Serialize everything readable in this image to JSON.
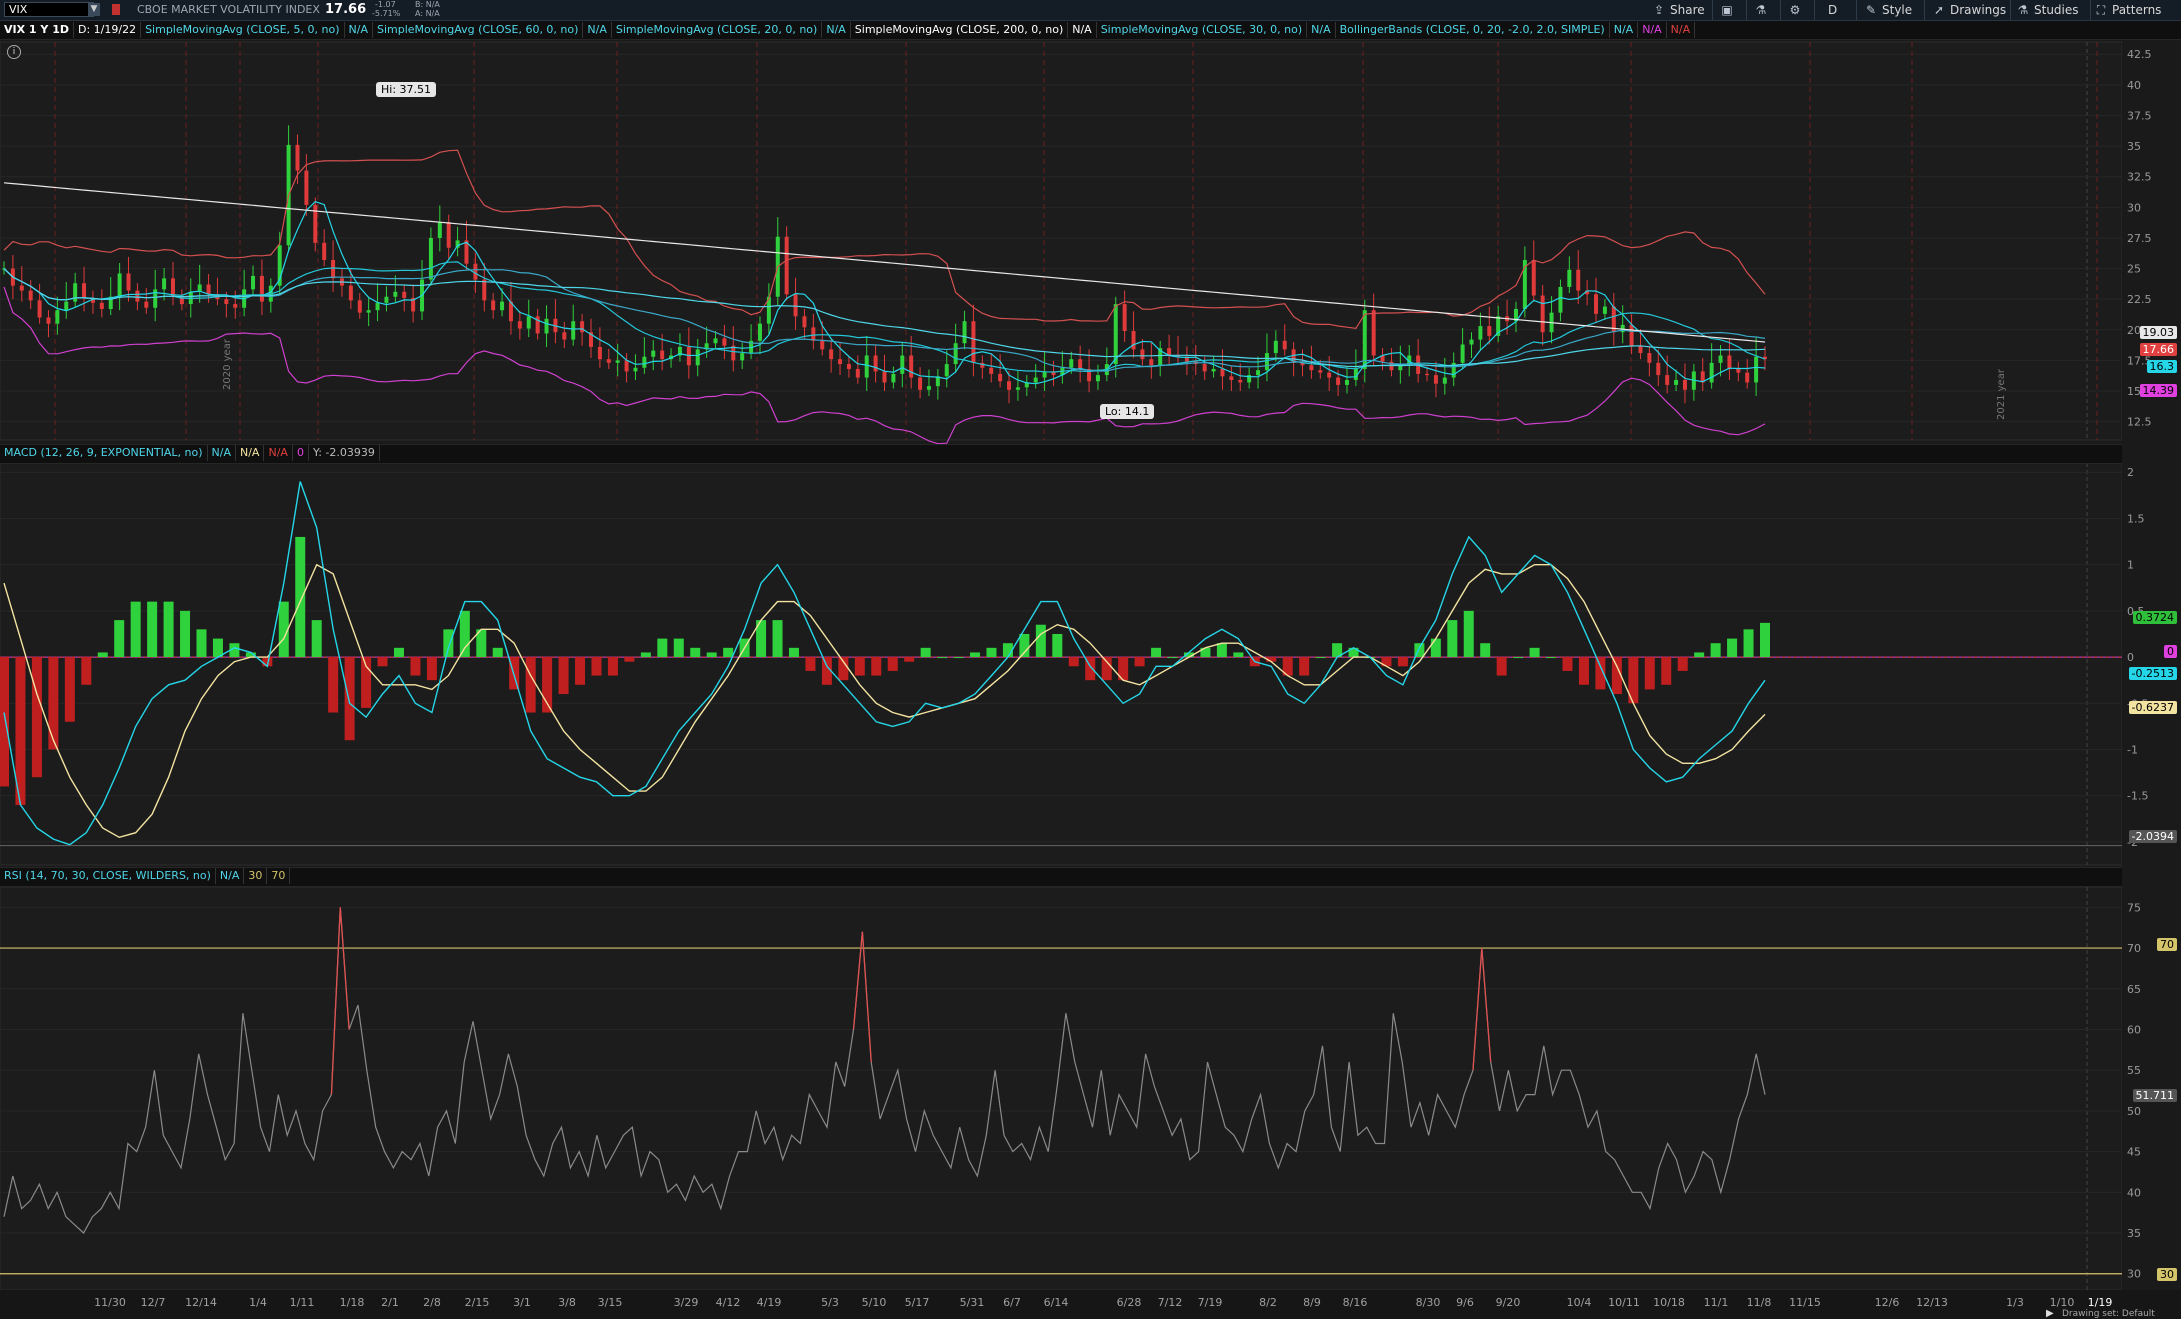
{
  "toolbar": {
    "symbol": "VIX",
    "description": "CBOE MARKET VOLATILITY INDEX",
    "last": "17.66",
    "change": "-1.07",
    "change_pct": "-5.71%",
    "bid": "B: N/A",
    "ask": "A: N/A",
    "share": "Share",
    "timeframe": "D",
    "style": "Style",
    "drawings": "Drawings",
    "studies": "Studies",
    "patterns": "Patterns"
  },
  "study_bar": {
    "chart_label": "VIX 1 Y 1D",
    "date": "D: 1/19/22",
    "studies": [
      {
        "label": "SimpleMovingAvg (CLOSE, 5, 0, no)",
        "value": "N/A",
        "color": "#4fd6e8"
      },
      {
        "label": "SimpleMovingAvg (CLOSE, 60, 0, no)",
        "value": "N/A",
        "color": "#4fd6e8"
      },
      {
        "label": "SimpleMovingAvg (CLOSE, 20, 0, no)",
        "value": "N/A",
        "color": "#4fd6e8"
      },
      {
        "label": "SimpleMovingAvg (CLOSE, 200, 0, no)",
        "value": "N/A",
        "color": "#ffffff"
      },
      {
        "label": "SimpleMovingAvg (CLOSE, 30, 0, no)",
        "value": "N/A",
        "color": "#4fd6e8"
      }
    ],
    "bollinger": {
      "label": "BollingerBands (CLOSE, 0, 20, -2.0, 2.0, SIMPLE)",
      "values": [
        "N/A",
        "N/A",
        "N/A"
      ]
    }
  },
  "price_panel": {
    "hi_label": "Hi: 37.51",
    "lo_label": "Lo: 14.1",
    "axis_ticks": [
      "42.5",
      "40",
      "37.5",
      "35",
      "32.5",
      "30",
      "27.5",
      "25",
      "22.5",
      "20",
      "17.5",
      "15",
      "12.5"
    ],
    "tags": [
      {
        "text": "19.03",
        "color": "#ffffff",
        "bg": "#e8e8e8",
        "fg": "#000000"
      },
      {
        "text": "17.66",
        "color": "#e04040",
        "bg": "#e04040",
        "fg": "#ffffff"
      },
      {
        "text": "16.3",
        "color": "#24d6e8",
        "bg": "#24d6e8",
        "fg": "#000000"
      },
      {
        "text": "14.39",
        "color": "#e040e0",
        "bg": "#e040e0",
        "fg": "#000000"
      }
    ],
    "year_labels": [
      "2020 year",
      "2021 year"
    ]
  },
  "macd_panel": {
    "label": "MACD (12, 26, 9, EXPONENTIAL, no)",
    "values": [
      "N/A",
      "N/A",
      "N/A",
      "0"
    ],
    "y_readout": "Y: -2.03939",
    "axis_ticks": [
      "2",
      "1.5",
      "1",
      "0.5",
      "0",
      "-0.5",
      "-1",
      "-1.5",
      "-2"
    ],
    "tags": [
      {
        "text": "0.3724",
        "bg": "#2fbf3a",
        "fg": "#000000"
      },
      {
        "text": "0",
        "bg": "#e040e0",
        "fg": "#000000"
      },
      {
        "text": "-0.2513",
        "bg": "#24d6e8",
        "fg": "#000000"
      },
      {
        "text": "-0.6237",
        "bg": "#f3e3a0",
        "fg": "#000000"
      },
      {
        "text": "-2.0394",
        "bg": "#555555",
        "fg": "#ffffff"
      }
    ]
  },
  "rsi_panel": {
    "label": "RSI (14, 70, 30, CLOSE, WILDERS, no)",
    "values": [
      "N/A",
      "30",
      "70"
    ],
    "axis_ticks": [
      "75",
      "70",
      "65",
      "60",
      "55",
      "50",
      "45",
      "40",
      "35",
      "30"
    ],
    "tags": [
      {
        "text": "70",
        "bg": "#d4c46a",
        "fg": "#000000"
      },
      {
        "text": "51.711",
        "bg": "#555555",
        "fg": "#ffffff"
      },
      {
        "text": "30",
        "bg": "#d4c46a",
        "fg": "#000000"
      }
    ]
  },
  "x_axis": {
    "labels": [
      "11/30",
      "12/7",
      "12/14",
      "1/4",
      "1/11",
      "1/18",
      "2/1",
      "2/8",
      "2/15",
      "3/1",
      "3/8",
      "3/15",
      "3/29",
      "4/12",
      "4/19",
      "5/3",
      "5/10",
      "5/17",
      "5/31",
      "6/7",
      "6/14",
      "6/28",
      "7/12",
      "7/19",
      "8/2",
      "8/9",
      "8/16",
      "8/30",
      "9/6",
      "9/20",
      "10/4",
      "10/11",
      "10/18",
      "11/1",
      "11/8",
      "11/15",
      "12/6",
      "12/13",
      "1/3",
      "1/10",
      "1/19"
    ]
  },
  "footer": {
    "drawing_set": "Drawing set: Default"
  },
  "chart_data": [
    {
      "type": "candlestick",
      "title": "VIX 1 Y 1D",
      "ylim": [
        11,
        43.5
      ],
      "hi": 37.51,
      "lo": 14.1,
      "close_series": [
        25,
        23.6,
        23.2,
        22.4,
        21,
        20.5,
        21.6,
        22.3,
        23.8,
        22.6,
        22.2,
        21.7,
        22.7,
        24.6,
        23.2,
        22.3,
        21.8,
        23.3,
        24.2,
        22.7,
        22.1,
        23.1,
        23.7,
        22.9,
        22.5,
        22.1,
        21.8,
        23.3,
        24.4,
        22.3,
        23.6,
        26.9,
        35.1,
        33,
        30.2,
        27.1,
        25.7,
        24.2,
        23.6,
        22.4,
        21.4,
        21.6,
        22.2,
        22.7,
        23.1,
        22.6,
        21.5,
        24.1,
        27.5,
        28.8,
        26.7,
        27.3,
        25.4,
        24.1,
        22.4,
        21.6,
        22.3,
        20.7,
        20.1,
        21.1,
        19.7,
        20.9,
        19.8,
        19.2,
        20.7,
        19.8,
        18.6,
        17.6,
        17.3,
        17.5,
        16.6,
        16.9,
        17.8,
        18.3,
        17.6,
        17.9,
        18.6,
        17.1,
        18.4,
        18.9,
        19.3,
        18.7,
        17.5,
        18.1,
        19.1,
        20.5,
        22.7,
        27.6,
        22.9,
        21.1,
        20.2,
        19.1,
        18.4,
        17.6,
        17.2,
        16.8,
        16.1,
        17.9,
        16.6,
        15.7,
        16.4,
        17.9,
        16.1,
        15.1,
        15.4,
        16.2,
        17.2,
        18.9,
        20.7,
        17.3,
        16.9,
        16.4,
        15.8,
        15.1,
        15.3,
        15.7,
        16.1,
        16.6,
        16.3,
        16.9,
        17.6,
        16.8,
        15.8,
        16.3,
        17.2,
        22.1,
        19.9,
        18.4,
        17.6,
        17.1,
        18.5,
        17.9,
        17.8,
        17.4,
        17.2,
        16.6,
        16.8,
        16.2,
        15.9,
        15.7,
        16.3,
        16.7,
        18.1,
        19.1,
        18.4,
        17.3,
        17.1,
        16.7,
        16.5,
        16.1,
        15.5,
        15.9,
        16.8,
        21.6,
        17.9,
        17.4,
        16.7,
        17.1,
        17.9,
        16.4,
        16.3,
        15.6,
        16.1,
        17.3,
        18.8,
        19.2,
        20.3,
        19.5,
        21.1,
        20.7,
        21.7,
        25.7,
        22.8,
        19.8,
        21.4,
        23.5,
        24.9,
        23.2,
        22.9,
        21.3,
        21.9,
        19.8,
        20.4,
        18.7,
        18.1,
        17.3,
        16.3,
        15.5,
        15.9,
        15.1,
        16.6,
        15.7,
        17.3,
        17.9,
        16.8,
        16.5,
        15.7,
        17.8,
        17.6
      ]
    },
    {
      "type": "line",
      "title": "MACD (12, 26, 9, EXPONENTIAL, no)",
      "ylim": [
        -2.25,
        2.1
      ],
      "series": [
        {
          "name": "Value",
          "color": "#24d6e8",
          "values": [
            -0.6,
            -1.6,
            -1.85,
            -1.97,
            -2.03,
            -1.9,
            -1.6,
            -1.2,
            -0.75,
            -0.45,
            -0.3,
            -0.25,
            -0.1,
            0.0,
            0.1,
            0.05,
            -0.1,
            0.8,
            1.9,
            1.4,
            0.3,
            -0.5,
            -0.65,
            -0.4,
            -0.2,
            -0.5,
            -0.6,
            0.1,
            0.6,
            0.6,
            0.4,
            -0.2,
            -0.8,
            -1.1,
            -1.2,
            -1.3,
            -1.35,
            -1.5,
            -1.5,
            -1.4,
            -1.1,
            -0.8,
            -0.6,
            -0.4,
            -0.1,
            0.3,
            0.8,
            1.0,
            0.7,
            0.3,
            -0.1,
            -0.3,
            -0.5,
            -0.7,
            -0.75,
            -0.7,
            -0.5,
            -0.55,
            -0.5,
            -0.4,
            -0.2,
            0.0,
            0.3,
            0.6,
            0.6,
            0.2,
            -0.1,
            -0.3,
            -0.5,
            -0.4,
            -0.1,
            -0.1,
            0.05,
            0.2,
            0.3,
            0.2,
            -0.05,
            -0.1,
            -0.4,
            -0.5,
            -0.3,
            0.0,
            0.1,
            0.0,
            -0.2,
            -0.3,
            0.1,
            0.4,
            0.9,
            1.3,
            1.1,
            0.7,
            0.9,
            1.1,
            1.0,
            0.7,
            0.3,
            -0.1,
            -0.5,
            -1.0,
            -1.2,
            -1.35,
            -1.3,
            -1.1,
            -0.95,
            -0.8,
            -0.5,
            -0.25
          ]
        },
        {
          "name": "Avg",
          "color": "#f3e3a0",
          "values": [
            0.8,
            0.2,
            -0.4,
            -0.9,
            -1.3,
            -1.6,
            -1.85,
            -1.95,
            -1.9,
            -1.7,
            -1.3,
            -0.8,
            -0.45,
            -0.2,
            -0.05,
            0.0,
            0.0,
            0.2,
            0.6,
            1.0,
            0.9,
            0.4,
            -0.1,
            -0.3,
            -0.3,
            -0.3,
            -0.35,
            -0.2,
            0.1,
            0.3,
            0.3,
            0.15,
            -0.2,
            -0.5,
            -0.8,
            -1.0,
            -1.15,
            -1.3,
            -1.45,
            -1.45,
            -1.3,
            -1.0,
            -0.7,
            -0.45,
            -0.2,
            0.1,
            0.4,
            0.6,
            0.6,
            0.45,
            0.2,
            -0.05,
            -0.3,
            -0.5,
            -0.6,
            -0.65,
            -0.6,
            -0.55,
            -0.5,
            -0.45,
            -0.3,
            -0.15,
            0.05,
            0.25,
            0.35,
            0.3,
            0.15,
            -0.05,
            -0.25,
            -0.3,
            -0.2,
            -0.1,
            0.0,
            0.1,
            0.15,
            0.15,
            0.05,
            -0.05,
            -0.2,
            -0.3,
            -0.3,
            -0.15,
            0.0,
            0.0,
            -0.1,
            -0.2,
            -0.05,
            0.2,
            0.5,
            0.8,
            0.95,
            0.9,
            0.9,
            1.0,
            1.0,
            0.85,
            0.6,
            0.25,
            -0.1,
            -0.5,
            -0.85,
            -1.05,
            -1.15,
            -1.15,
            -1.1,
            -1.0,
            -0.8,
            -0.62
          ]
        },
        {
          "name": "Diff",
          "color": "#2fbf3a",
          "values": [
            -1.4,
            -1.6,
            -1.3,
            -1.0,
            -0.7,
            -0.3,
            0.05,
            0.4,
            0.6,
            0.6,
            0.6,
            0.5,
            0.3,
            0.2,
            0.15,
            0.05,
            -0.1,
            0.6,
            1.3,
            0.4,
            -0.6,
            -0.9,
            -0.55,
            -0.1,
            0.1,
            -0.2,
            -0.25,
            0.3,
            0.5,
            0.3,
            0.1,
            -0.35,
            -0.6,
            -0.6,
            -0.4,
            -0.3,
            -0.2,
            -0.2,
            -0.05,
            0.05,
            0.2,
            0.2,
            0.1,
            0.05,
            0.1,
            0.2,
            0.4,
            0.4,
            0.1,
            -0.15,
            -0.3,
            -0.25,
            -0.2,
            -0.2,
            -0.15,
            -0.05,
            0.1,
            0.0,
            0.0,
            0.05,
            0.1,
            0.15,
            0.25,
            0.35,
            0.25,
            -0.1,
            -0.25,
            -0.25,
            -0.25,
            -0.1,
            0.1,
            0.0,
            0.05,
            0.1,
            0.15,
            0.05,
            -0.1,
            -0.05,
            -0.2,
            -0.2,
            0.0,
            0.15,
            0.1,
            0.0,
            -0.1,
            -0.1,
            0.15,
            0.2,
            0.4,
            0.5,
            0.15,
            -0.2,
            0.0,
            0.1,
            0.0,
            -0.15,
            -0.3,
            -0.35,
            -0.4,
            -0.5,
            -0.35,
            -0.3,
            -0.15,
            0.05,
            0.15,
            0.2,
            0.3,
            0.37
          ]
        }
      ]
    },
    {
      "type": "line",
      "title": "RSI (14, 70, 30, CLOSE, WILDERS, no)",
      "ylim": [
        28,
        77.5
      ],
      "overbought": 70,
      "oversold": 30,
      "series": [
        {
          "name": "RSI",
          "color": "#8a8a8a",
          "values": [
            37,
            42,
            38,
            39,
            41,
            38,
            40,
            37,
            36,
            35,
            37,
            38,
            40,
            38,
            46,
            45,
            48,
            55,
            47,
            45,
            43,
            49,
            57,
            52,
            48,
            44,
            46,
            62,
            55,
            48,
            45,
            52,
            47,
            50,
            46,
            44,
            50,
            52,
            75,
            60,
            63,
            55,
            48,
            45,
            43,
            45,
            44,
            46,
            42,
            48,
            50,
            46,
            56,
            61,
            55,
            49,
            52,
            57,
            53,
            47,
            44,
            42,
            46,
            48,
            43,
            45,
            42,
            47,
            43,
            45,
            47,
            48,
            42,
            45,
            44,
            40,
            41,
            39,
            42,
            40,
            41,
            38,
            42,
            45,
            45,
            50,
            46,
            48,
            44,
            47,
            46,
            52,
            50,
            48,
            56,
            53,
            60,
            72,
            56,
            49,
            52,
            55,
            49,
            45,
            50,
            47,
            45,
            43,
            48,
            44,
            42,
            47,
            55,
            47,
            45,
            46,
            44,
            48,
            45,
            53,
            62,
            56,
            52,
            48,
            55,
            47,
            52,
            50,
            48,
            57,
            53,
            50,
            47,
            49,
            44,
            45,
            56,
            52,
            48,
            47,
            45,
            49,
            52,
            46,
            43,
            46,
            45,
            50,
            52,
            58,
            48,
            45,
            56,
            47,
            48,
            46,
            46,
            62,
            56,
            48,
            51,
            47,
            52,
            50,
            48,
            52,
            55,
            70,
            56,
            50,
            55,
            50,
            52,
            52,
            58,
            52,
            55,
            55,
            52,
            48,
            50,
            45,
            44,
            42,
            40,
            40,
            38,
            43,
            46,
            44,
            40,
            42,
            45,
            44,
            40,
            44,
            49,
            52,
            57,
            52
          ]
        }
      ]
    }
  ]
}
